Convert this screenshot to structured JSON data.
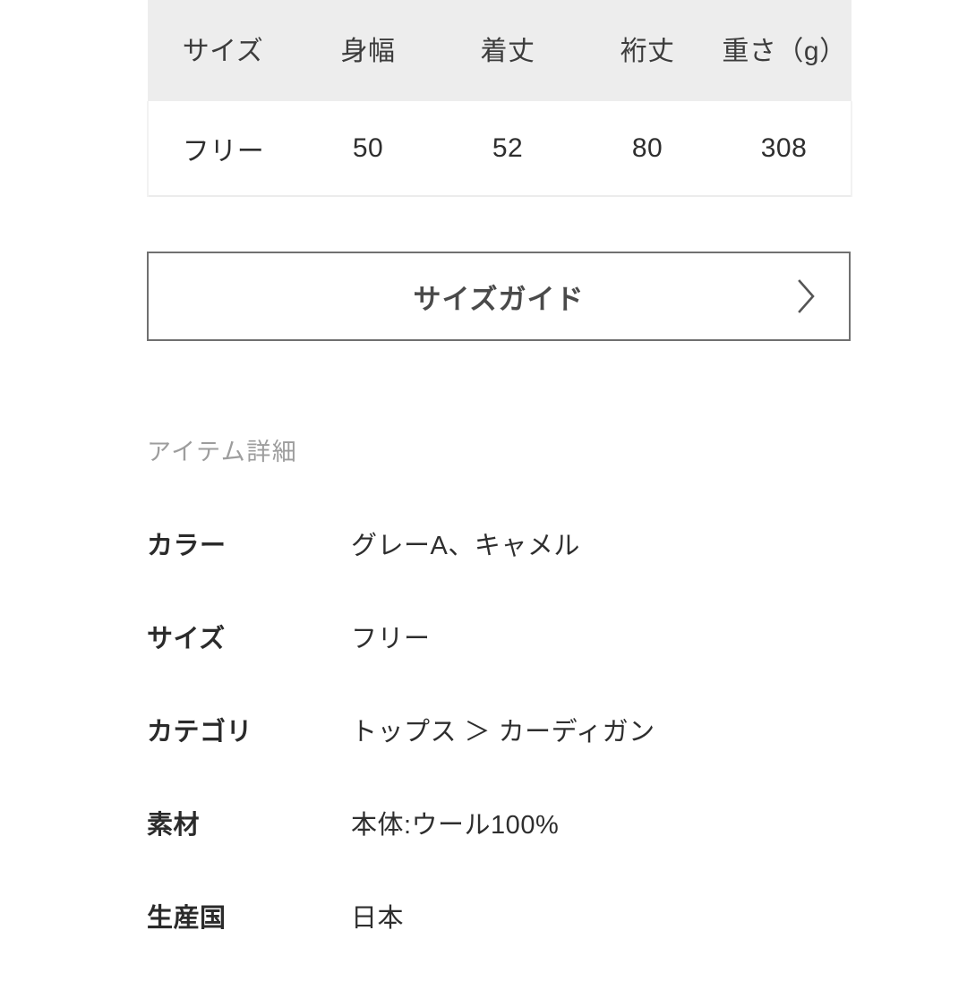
{
  "size_table": {
    "headers": [
      "サイズ",
      "身幅",
      "着丈",
      "裄丈",
      "重さ（g）"
    ],
    "rows": [
      {
        "size": "フリー",
        "body_width": "50",
        "body_length": "52",
        "sleeve_length": "80",
        "weight": "308"
      }
    ]
  },
  "size_guide": {
    "label": "サイズガイド",
    "chevron_icon": "chevron-right-icon"
  },
  "item_details": {
    "heading": "アイテム詳細",
    "rows": [
      {
        "label": "カラー",
        "value": "グレーA、キャメル"
      },
      {
        "label": "サイズ",
        "value": "フリー"
      },
      {
        "label": "カテゴリ",
        "value": "トップス ＞ カーディガン"
      },
      {
        "label": "素材",
        "value": "本体:ウール100%"
      },
      {
        "label": "生産国",
        "value": "日本"
      }
    ]
  },
  "colors": {
    "background": "#ffffff",
    "table_header_bg": "#ededed",
    "table_border": "#ececec",
    "button_border": "#707070",
    "button_text": "#4a4a4a",
    "heading_text": "#9d9d9d",
    "body_text": "#2e2e2e"
  }
}
